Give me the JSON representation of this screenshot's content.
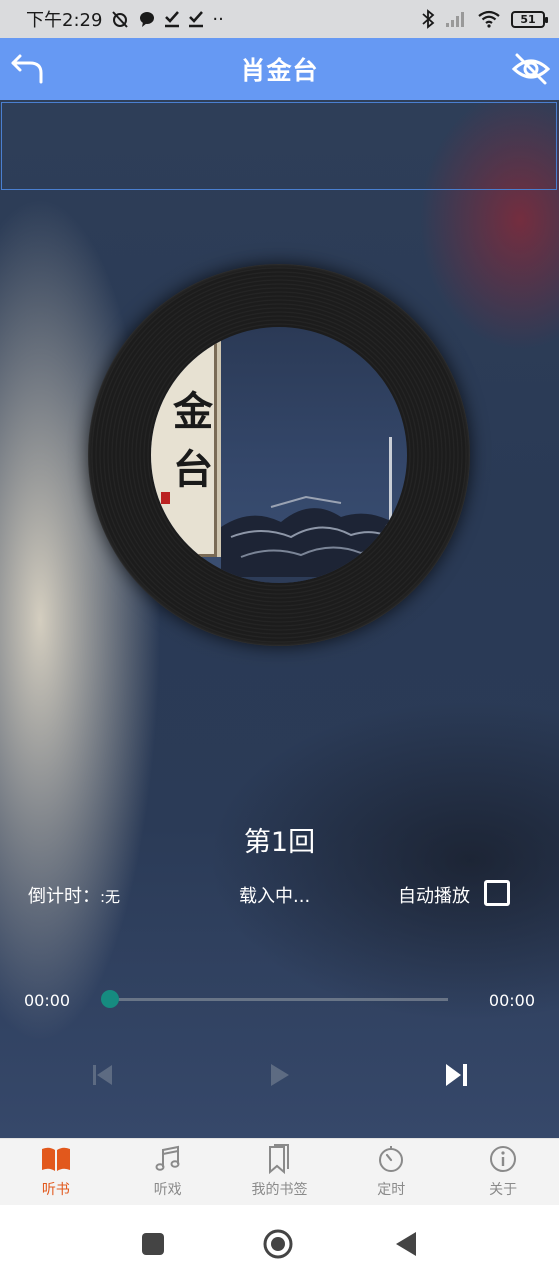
{
  "status_bar": {
    "time": "下午2:29",
    "dots": "··",
    "battery": "51"
  },
  "header": {
    "title": "肖金台"
  },
  "cover": {
    "char1": "金",
    "char2": "台"
  },
  "player": {
    "chapter": "第1回",
    "countdown_label": "倒计时：",
    "countdown_value": ":无",
    "loading_text": "载入中...",
    "autoplay_label": "自动播放",
    "autoplay_checked": false,
    "current_time": "00:00",
    "total_time": "00:00",
    "progress_fraction": 0
  },
  "bottom_nav": {
    "items": [
      {
        "label": "听书",
        "icon": "book-open-icon",
        "active": true
      },
      {
        "label": "听戏",
        "icon": "music-note-icon",
        "active": false
      },
      {
        "label": "我的书签",
        "icon": "bookmark-icon",
        "active": false
      },
      {
        "label": "定时",
        "icon": "timer-icon",
        "active": false
      },
      {
        "label": "关于",
        "icon": "info-icon",
        "active": false
      }
    ]
  },
  "colors": {
    "title_bar": "#6699f3",
    "active_tab": "#e2581c",
    "inactive_tab": "#8a8a8a",
    "progress_thumb": "#168b80"
  }
}
